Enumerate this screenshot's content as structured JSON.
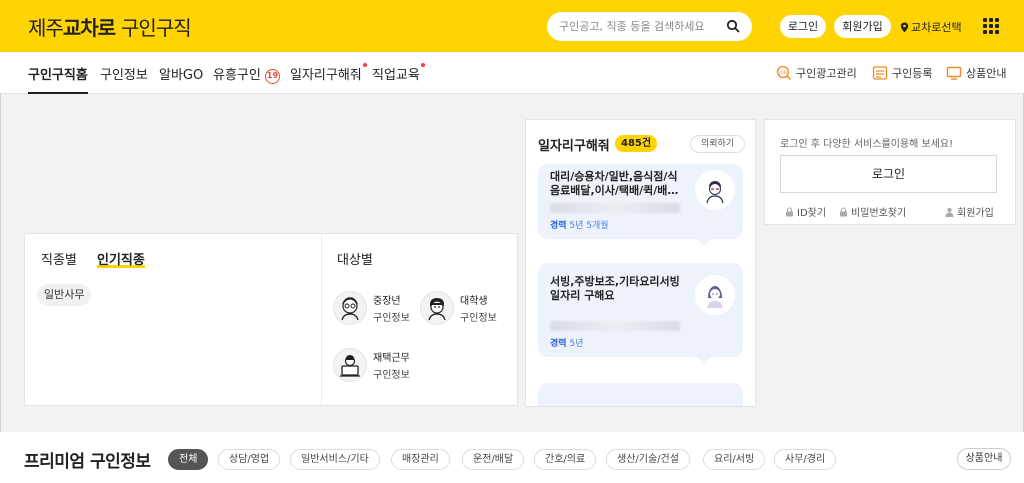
{
  "header": {
    "logo": {
      "part1": "제주",
      "part2": "교차로",
      "part3": "구인구직"
    },
    "search_placeholder": "구인공고, 직종 등을 검색하세요",
    "login_label": "로그인",
    "join_label": "회원가입",
    "region_label": "교차로선택"
  },
  "nav": {
    "items": [
      {
        "label": "구인구직홈"
      },
      {
        "label": "구인정보"
      },
      {
        "label": "알바GO"
      },
      {
        "label": "유흥구인",
        "badge": "19"
      },
      {
        "label": "일자리구해줘"
      },
      {
        "label": "직업교육"
      }
    ],
    "right": [
      {
        "label": "구인광고관리",
        "icon": "job-ad-icon"
      },
      {
        "label": "구인등록",
        "icon": "register-icon"
      },
      {
        "label": "상품안내",
        "icon": "monitor-icon"
      }
    ]
  },
  "category": {
    "tab1": "직종별",
    "tab2": "인기직종",
    "chip": "일반사무",
    "target_title": "대상별",
    "targets": [
      {
        "title": "중장년",
        "sub": "구인정보"
      },
      {
        "title": "대학생",
        "sub": "구인정보"
      },
      {
        "title": "재택근무",
        "sub": "구인정보"
      }
    ]
  },
  "requests": {
    "title": "일자리구해줘",
    "count": "485건",
    "ask_label": "의뢰하기",
    "items": [
      {
        "text": "대리/승용차/일반,음식점/식음료배달,이사/택배/퀵/배…",
        "exp_label": "경력",
        "exp_value": "5년 5개월"
      },
      {
        "text": "서빙,주방보조,기타요리서빙 일자리 구해요",
        "exp_label": "경력",
        "exp_value": "5년"
      }
    ]
  },
  "login_box": {
    "message": "로그인 후 다양한 서비스를이용해 보세요!",
    "button": "로그인",
    "find_id": "ID찾기",
    "find_pw": "비밀번호찾기",
    "join": "회원가입"
  },
  "premium": {
    "title": "프리미엄 구인정보",
    "filters": [
      "전체",
      "상담/영업",
      "일반서비스/기타",
      "매장관리",
      "운전/배달",
      "간호/의료",
      "생산/기술/건설",
      "요리/서빙",
      "사무/경리"
    ],
    "product_info": "상품안내"
  },
  "colors": {
    "brand_yellow": "#ffd400",
    "accent_blue": "#2b5fd8",
    "alert_red": "#e74c3c"
  }
}
